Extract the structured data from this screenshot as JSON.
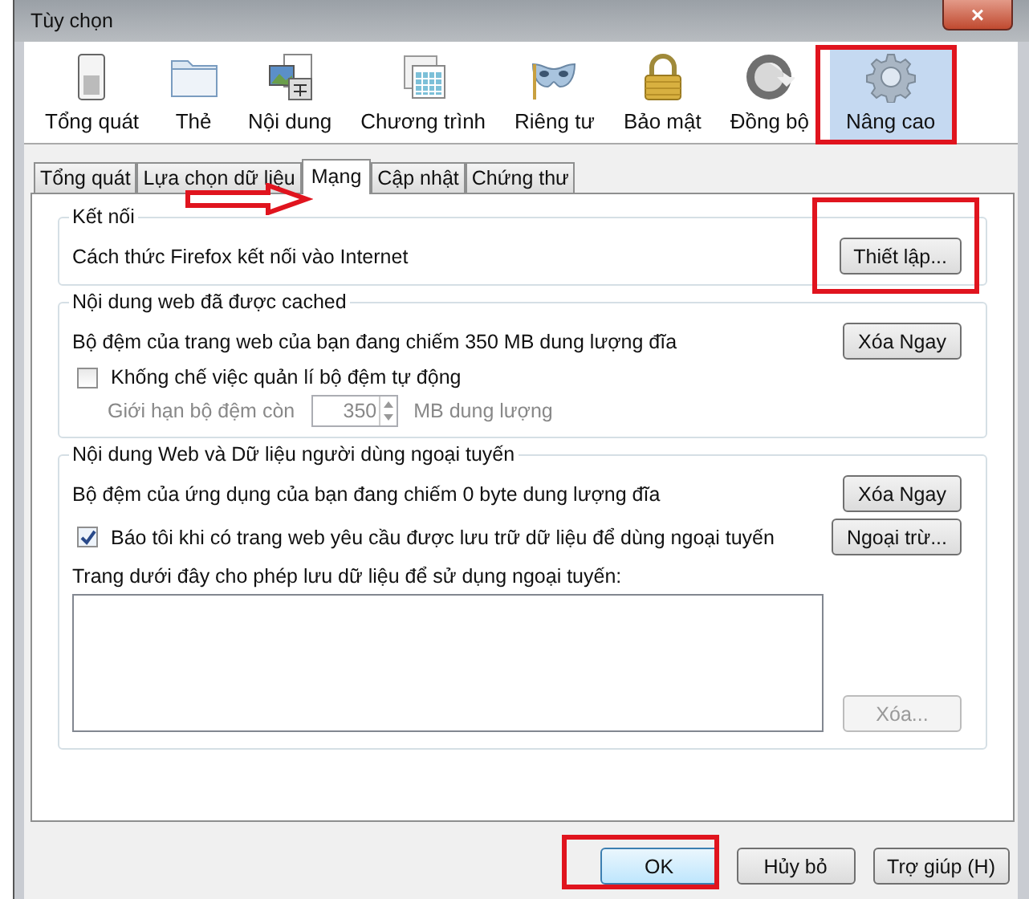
{
  "window": {
    "title": "Tùy chọn",
    "close": "×"
  },
  "toolbar": [
    {
      "label": "Tổng quát",
      "selected": false
    },
    {
      "label": "Thẻ",
      "selected": false
    },
    {
      "label": "Nội dung",
      "selected": false
    },
    {
      "label": "Chương trình",
      "selected": false
    },
    {
      "label": "Riêng tư",
      "selected": false
    },
    {
      "label": "Bảo mật",
      "selected": false
    },
    {
      "label": "Đồng bộ",
      "selected": false
    },
    {
      "label": "Nâng cao",
      "selected": true
    }
  ],
  "tabs": [
    {
      "label": "Tổng quát",
      "selected": false
    },
    {
      "label": "Lựa chọn dữ liệu",
      "selected": false
    },
    {
      "label": "Mạng",
      "selected": true
    },
    {
      "label": "Cập nhật",
      "selected": false
    },
    {
      "label": "Chứng thư",
      "selected": false
    }
  ],
  "connection": {
    "legend": "Kết nối",
    "text": "Cách thức Firefox kết nối vào Internet",
    "button": "Thiết lập..."
  },
  "cache": {
    "legend": "Nội dung web đã được cached",
    "text": "Bộ đệm của trang web của bạn đang chiếm 350 MB dung lượng đĩa",
    "button": "Xóa Ngay",
    "checkbox": {
      "label": "Khống chế việc quản lí bộ đệm tự động",
      "checked": false
    },
    "limit": {
      "label": "Giới hạn bộ đệm còn",
      "value": "350",
      "unit": "MB dung lượng",
      "disabled": true
    }
  },
  "offline": {
    "legend": "Nội dung Web và Dữ liệu người dùng ngoại tuyến",
    "text": "Bộ đệm của ứng dụng của bạn đang chiếm 0 byte dung lượng đĩa",
    "button": "Xóa Ngay",
    "checkbox": {
      "label": "Báo tôi khi có trang web yêu cầu được lưu trữ dữ liệu để dùng ngoại tuyến",
      "checked": true
    },
    "exceptions_button": "Ngoại trừ...",
    "list_label": "Trang dưới đây cho phép lưu dữ liệu để sử dụng ngoại tuyến:",
    "remove_button": {
      "label": "Xóa...",
      "disabled": true
    }
  },
  "buttons": [
    "OK",
    "Hủy bỏ",
    "Trợ giúp (H)"
  ]
}
